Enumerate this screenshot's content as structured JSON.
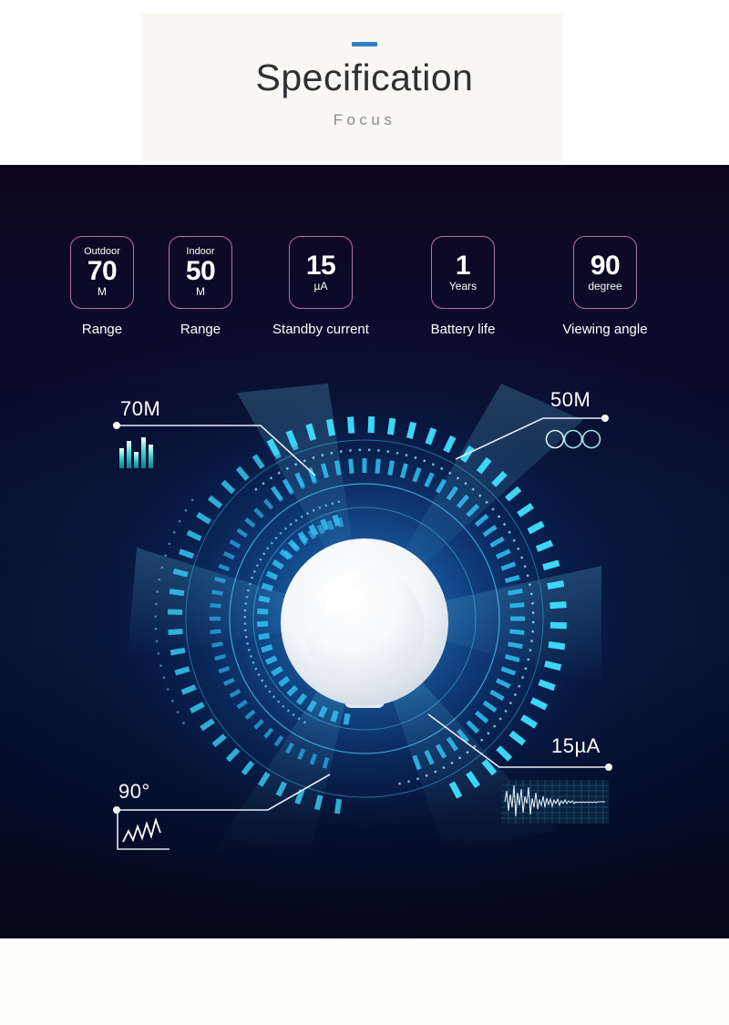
{
  "header": {
    "dash_color": "#2d81c4",
    "title": "Specification",
    "subtitle": "Focus"
  },
  "specs": {
    "items": [
      {
        "tag": "Outdoor",
        "value": "70",
        "unit": "M",
        "label": "Range"
      },
      {
        "tag": "Indoor",
        "value": "50",
        "unit": "M",
        "label": "Range"
      },
      {
        "tag": "",
        "value": "15",
        "unit": "µA",
        "label": "Standby current"
      },
      {
        "tag": "",
        "value": "1",
        "unit": "Years",
        "label": "Battery life"
      },
      {
        "tag": "",
        "value": "90",
        "unit": "degree",
        "label": "Viewing angle"
      }
    ],
    "border_color": "#b4739c",
    "text_color": "#ffffff"
  },
  "diagram": {
    "background_color": "#0c0620",
    "accent_color": "#2fd2f5",
    "device": "pir-motion-sensor-dome",
    "callouts": [
      {
        "id": "range-outdoor",
        "text": "70M",
        "icon": "bar-levels-icon",
        "position": "top-left"
      },
      {
        "id": "range-indoor",
        "text": "50M",
        "icon": "three-circles-icon",
        "position": "top-right"
      },
      {
        "id": "standby",
        "text": "15µA",
        "icon": "waveform-icon",
        "position": "bottom-right"
      },
      {
        "id": "angle",
        "text": "90°",
        "icon": "zigzag-chart-icon",
        "position": "bottom-left"
      }
    ]
  }
}
